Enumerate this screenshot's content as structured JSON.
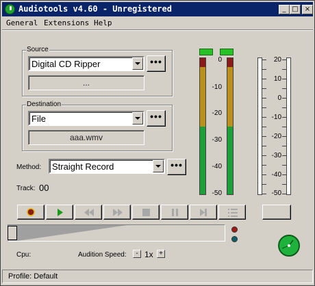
{
  "window": {
    "title": "Audiotools v4.60 - Unregistered",
    "minimize_icon": "_",
    "maximize_icon": "□",
    "close_icon": "×"
  },
  "menu": [
    "General",
    "Extensions",
    "Help"
  ],
  "source": {
    "legend": "Source",
    "selected": "Digital CD Ripper",
    "info_text": "...",
    "more_label": "•••"
  },
  "destination": {
    "legend": "Destination",
    "selected": "File",
    "file_name": "aaa.wmv",
    "more_label": "•••"
  },
  "method": {
    "label": "Method:",
    "selected": "Straight Record",
    "more_label": "•••"
  },
  "track": {
    "label": "Track:",
    "value": "00"
  },
  "vu_meter": {
    "scale": [
      "0",
      "-10",
      "-20",
      "-30",
      "-40",
      "-50"
    ],
    "led_color": "#27c127"
  },
  "right_meter": {
    "scale": [
      "20",
      "10",
      "0",
      "-10",
      "-20",
      "-30",
      "-40",
      "-50"
    ]
  },
  "transport": [
    "record",
    "play",
    "rewind",
    "fast-forward",
    "stop",
    "pause",
    "skip-end",
    "playlist"
  ],
  "cpu": {
    "label": "Cpu:"
  },
  "audition": {
    "label": "Audition Speed:",
    "minus": "-",
    "value": "1x",
    "plus": "+"
  },
  "status_bar": {
    "text": "Profile: Default"
  },
  "colors": {
    "title_bg": "#0a246a",
    "meter_red": "#8b1a1a",
    "meter_yellow": "#b8901c",
    "meter_green": "#1c9f3a"
  }
}
